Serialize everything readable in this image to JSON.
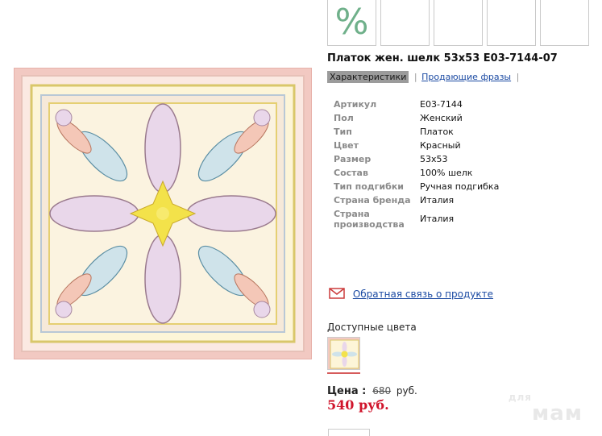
{
  "gallery": {
    "thumbnails": [
      {
        "icon": "percent-icon",
        "glyph": "%"
      },
      {
        "icon": "blank-thumbnail"
      },
      {
        "icon": "blank-thumbnail"
      },
      {
        "icon": "blank-thumbnail"
      },
      {
        "icon": "blank-thumbnail"
      }
    ]
  },
  "product": {
    "title": "Платок жен. шелк 53x53 E03-7144-07",
    "tabs": {
      "characteristics": "Характеристики",
      "selling_phrases": "Продающие фразы",
      "separator": "|"
    },
    "specs": [
      {
        "key": "Артикул",
        "value": "E03-7144"
      },
      {
        "key": "Пол",
        "value": "Женский"
      },
      {
        "key": "Тип",
        "value": "Платок"
      },
      {
        "key": "Цвет",
        "value": "Красный"
      },
      {
        "key": "Размер",
        "value": "53x53"
      },
      {
        "key": "Состав",
        "value": "100% шелк"
      },
      {
        "key": "Тип подгибки",
        "value": "Ручная подгибка"
      },
      {
        "key": "Страна бренда",
        "value": "Италия"
      },
      {
        "key": "Страна производства",
        "value": "Италия"
      }
    ],
    "feedback_link": "Обратная связь о продукте",
    "available_colors_label": "Доступные цвета",
    "price": {
      "label": "Цена :",
      "old": "680",
      "currency_small": "руб.",
      "new": "540 руб."
    }
  },
  "watermark": {
    "small": "для",
    "big": "мам"
  },
  "colors": {
    "link": "#1c4ba3",
    "price_red": "#d0142b",
    "scarf_border": "#f2c9c2",
    "scarf_yellow": "#f3e24a",
    "percent_green": "#6fb08a"
  }
}
